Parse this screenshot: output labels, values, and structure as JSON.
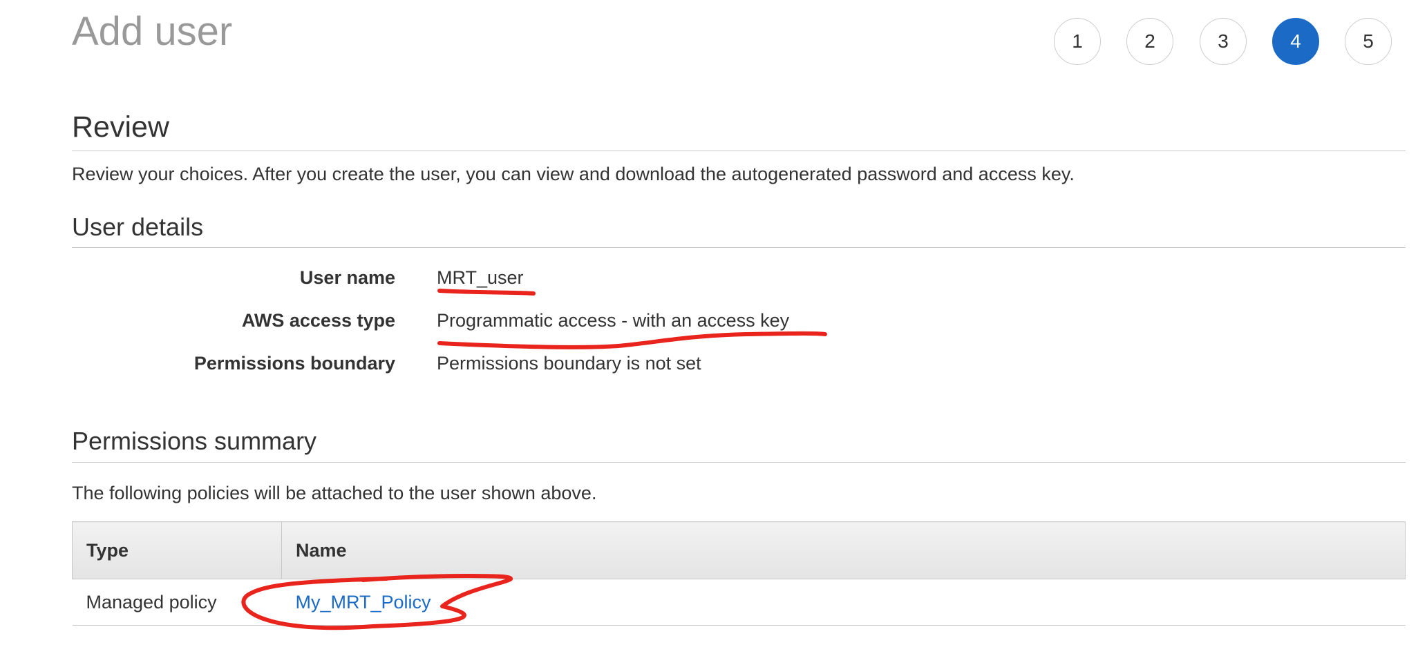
{
  "header": {
    "title": "Add user",
    "steps": [
      {
        "label": "1",
        "active": false
      },
      {
        "label": "2",
        "active": false
      },
      {
        "label": "3",
        "active": false
      },
      {
        "label": "4",
        "active": true
      },
      {
        "label": "5",
        "active": false
      }
    ]
  },
  "review": {
    "title": "Review",
    "description": "Review your choices. After you create the user, you can view and download the autogenerated password and access key."
  },
  "user_details": {
    "title": "User details",
    "rows": [
      {
        "label": "User name",
        "value": "MRT_user"
      },
      {
        "label": "AWS access type",
        "value": "Programmatic access - with an access key"
      },
      {
        "label": "Permissions boundary",
        "value": "Permissions boundary is not set"
      }
    ]
  },
  "permissions": {
    "title": "Permissions summary",
    "description": "The following policies will be attached to the user shown above.",
    "columns": [
      "Type",
      "Name"
    ],
    "rows": [
      {
        "type": "Managed policy",
        "name": "My_MRT_Policy"
      }
    ]
  },
  "colors": {
    "accent": "#1a6ac6",
    "annotation": "#e8241c"
  }
}
